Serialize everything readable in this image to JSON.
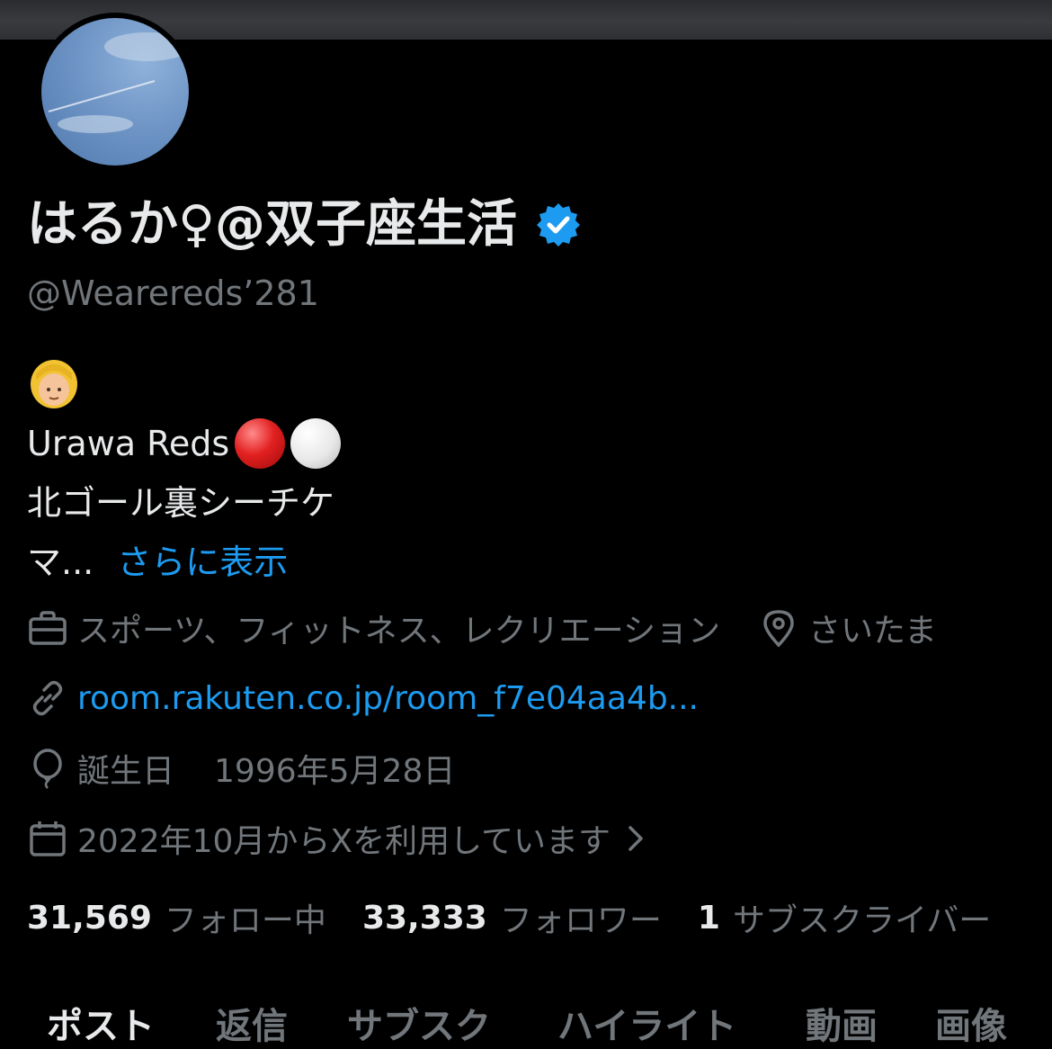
{
  "profile": {
    "display_name": "はるか♀@双子座生活",
    "handle": "@Weareredsʼ281",
    "verified_icon": "verified-badge-icon"
  },
  "bio": {
    "line1_emoji": "woman-blond-hair-emoji",
    "line2": "Urawa Reds",
    "line2_emojis": [
      "red-circle",
      "white-circle"
    ],
    "line3": "北ゴール裏シーチケ",
    "line4": "マ...",
    "more_link": "さらに表示"
  },
  "meta": {
    "category": "スポーツ、フィットネス、レクリエーション",
    "location": "さいたま",
    "url": "room.rakuten.co.jp/room_f7e04aa4b...",
    "birthday_label": "誕生日",
    "birthday": "1996年5月28日",
    "joined": "2022年10月からXを利用しています"
  },
  "stats": {
    "following_count": "31,569",
    "following_label": "フォロー中",
    "followers_count": "33,333",
    "followers_label": "フォロワー",
    "subscribers_count": "1",
    "subscribers_label": "サブスクライバー"
  },
  "tabs": [
    "ポスト",
    "返信",
    "サブスク",
    "ハイライト",
    "動画",
    "画像"
  ],
  "colors": {
    "background": "#000000",
    "text": "#e7e9ea",
    "secondary": "#71767b",
    "link": "#1d9bf0"
  }
}
